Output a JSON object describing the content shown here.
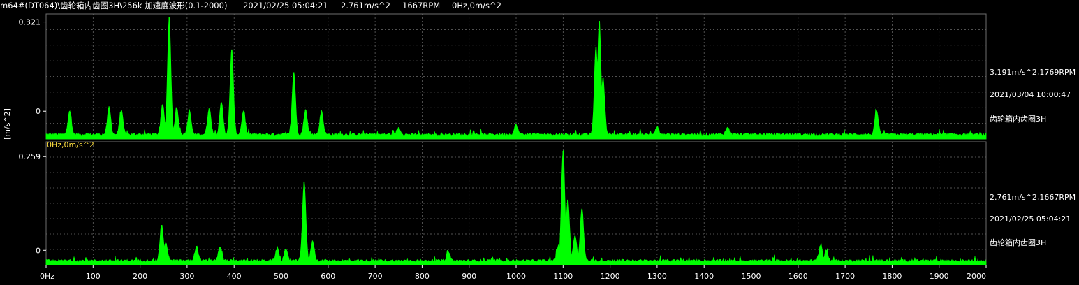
{
  "header": {
    "channel": "m64#(DT064)\\齿轮箱内齿圈3H\\256k 加速度波形(0.1-2000)",
    "datetime": "2021/02/25 05:04:21",
    "amplitude": "2.761m/s^2",
    "speed": "1667RPM",
    "cursor": "0Hz,0m/s^2"
  },
  "y_unit": "[m/s^2]",
  "cursor_readout": "0Hz,0m/s^2",
  "colors": {
    "trace": "#00ff00",
    "grid": "#6e6e6e",
    "background": "#000000",
    "cursor_text": "#ffdf40",
    "text": "#ffffff"
  },
  "chart_data": [
    {
      "type": "line",
      "name_label": "齿轮箱内齿圈3H",
      "info_amplitude_speed": "3.191m/s^2,1769RPM",
      "info_datetime": "2021/03/04 10:00:47",
      "ylim": [
        -0.1,
        0.35
      ],
      "ytick_values": [
        0,
        0.321
      ],
      "ytick_labels": [
        "0",
        "0.321"
      ],
      "xlim": [
        0,
        2000
      ],
      "baseline": -0.1,
      "floor": -0.085,
      "peaks": [
        [
          50,
          0.0
        ],
        [
          134,
          0.013
        ],
        [
          160,
          0.0
        ],
        [
          248,
          0.022
        ],
        [
          262,
          0.337
        ],
        [
          278,
          0.014
        ],
        [
          305,
          0.0
        ],
        [
          347,
          0.01
        ],
        [
          373,
          0.03
        ],
        [
          395,
          0.222
        ],
        [
          420,
          0.0
        ],
        [
          527,
          0.14
        ],
        [
          552,
          0.004
        ],
        [
          586,
          0.0
        ],
        [
          750,
          -0.06
        ],
        [
          1000,
          -0.05
        ],
        [
          1170,
          0.23
        ],
        [
          1177,
          0.325
        ],
        [
          1185,
          0.12
        ],
        [
          1300,
          -0.06
        ],
        [
          1450,
          -0.06
        ],
        [
          1767,
          0.002
        ]
      ],
      "grid": true
    },
    {
      "type": "line",
      "name_label": "齿轮箱内齿圈3H",
      "info_amplitude_speed": "2.761m/s^2,1667RPM",
      "info_datetime": "2021/02/25 05:04:21",
      "ylim": [
        -0.04,
        0.3
      ],
      "ytick_values": [
        0,
        0.259
      ],
      "ytick_labels": [
        "0",
        "0.259"
      ],
      "xlim": [
        0,
        2000
      ],
      "baseline": -0.04,
      "floor": -0.03,
      "xticks": [
        0,
        100,
        200,
        300,
        400,
        500,
        600,
        700,
        800,
        900,
        1000,
        1100,
        1200,
        1300,
        1400,
        1500,
        1600,
        1700,
        1800,
        1900,
        2000
      ],
      "xtick_labels": [
        "0Hz",
        "100",
        "200",
        "300",
        "400",
        "500",
        "600",
        "700",
        "800",
        "900",
        "1000",
        "1100",
        "1200",
        "1300",
        "1400",
        "1500",
        "1600",
        "1700",
        "1800",
        "1900",
        "2000"
      ],
      "peaks": [
        [
          246,
          0.07
        ],
        [
          255,
          0.02
        ],
        [
          320,
          0.01
        ],
        [
          370,
          0.01
        ],
        [
          492,
          0.005
        ],
        [
          510,
          0.0
        ],
        [
          549,
          0.19
        ],
        [
          567,
          0.025
        ],
        [
          856,
          -0.005
        ],
        [
          1090,
          0.01
        ],
        [
          1100,
          0.275
        ],
        [
          1110,
          0.14
        ],
        [
          1125,
          0.04
        ],
        [
          1140,
          0.115
        ],
        [
          1648,
          0.012
        ],
        [
          1660,
          0.0
        ]
      ],
      "grid": true
    }
  ]
}
